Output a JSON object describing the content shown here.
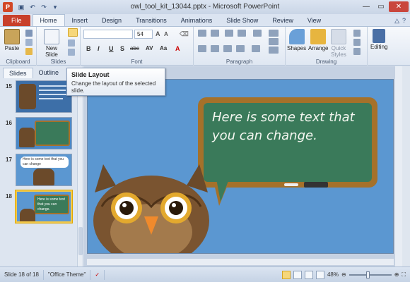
{
  "window": {
    "title": "owl_tool_kit_13044.pptx - Microsoft PowerPoint",
    "app_icon": "powerpoint-icon",
    "controls": [
      "minimize",
      "maximize",
      "close"
    ]
  },
  "quick_access": [
    "save-icon",
    "undo-icon",
    "redo-icon",
    "customize-icon"
  ],
  "tabs": [
    "File",
    "Home",
    "Insert",
    "Design",
    "Transitions",
    "Animations",
    "Slide Show",
    "Review",
    "View"
  ],
  "active_tab": "Home",
  "ribbon": {
    "groups": {
      "clipboard": "Clipboard",
      "slides": "Slides",
      "font": "Font",
      "paragraph": "Paragraph",
      "drawing": "Drawing"
    },
    "buttons": {
      "paste": "Paste",
      "new_slide_line1": "New",
      "new_slide_line2": "Slide",
      "shapes": "Shapes",
      "arrange": "Arrange",
      "quick_styles_line1": "Quick",
      "quick_styles_line2": "Styles",
      "editing": "Editing"
    },
    "font_size": "54",
    "format_buttons": [
      "B",
      "I",
      "U",
      "S",
      "abc",
      "AV",
      "Aa",
      "A"
    ]
  },
  "tooltip": {
    "title": "Slide Layout",
    "description": "Change the layout of the selected slide."
  },
  "left_pane": {
    "tabs": [
      "Slides",
      "Outline"
    ],
    "active_tab": "Slides",
    "thumbnails": [
      {
        "number": "15"
      },
      {
        "number": "16"
      },
      {
        "number": "17",
        "text": "Here is some text that you can change"
      },
      {
        "number": "18",
        "text": "Here is some text that you can change.",
        "selected": true
      }
    ]
  },
  "slide": {
    "text": "Here is some text that you can change."
  },
  "statusbar": {
    "slide_info": "Slide 18 of 18",
    "theme": "\"Office Theme\"",
    "zoom": "48%",
    "zoom_level": 0.48
  },
  "colors": {
    "file_tab": "#c8402b",
    "slide_background": "#5b97d1",
    "chalkboard": "#3a7a5a",
    "frame": "#a5712a"
  }
}
